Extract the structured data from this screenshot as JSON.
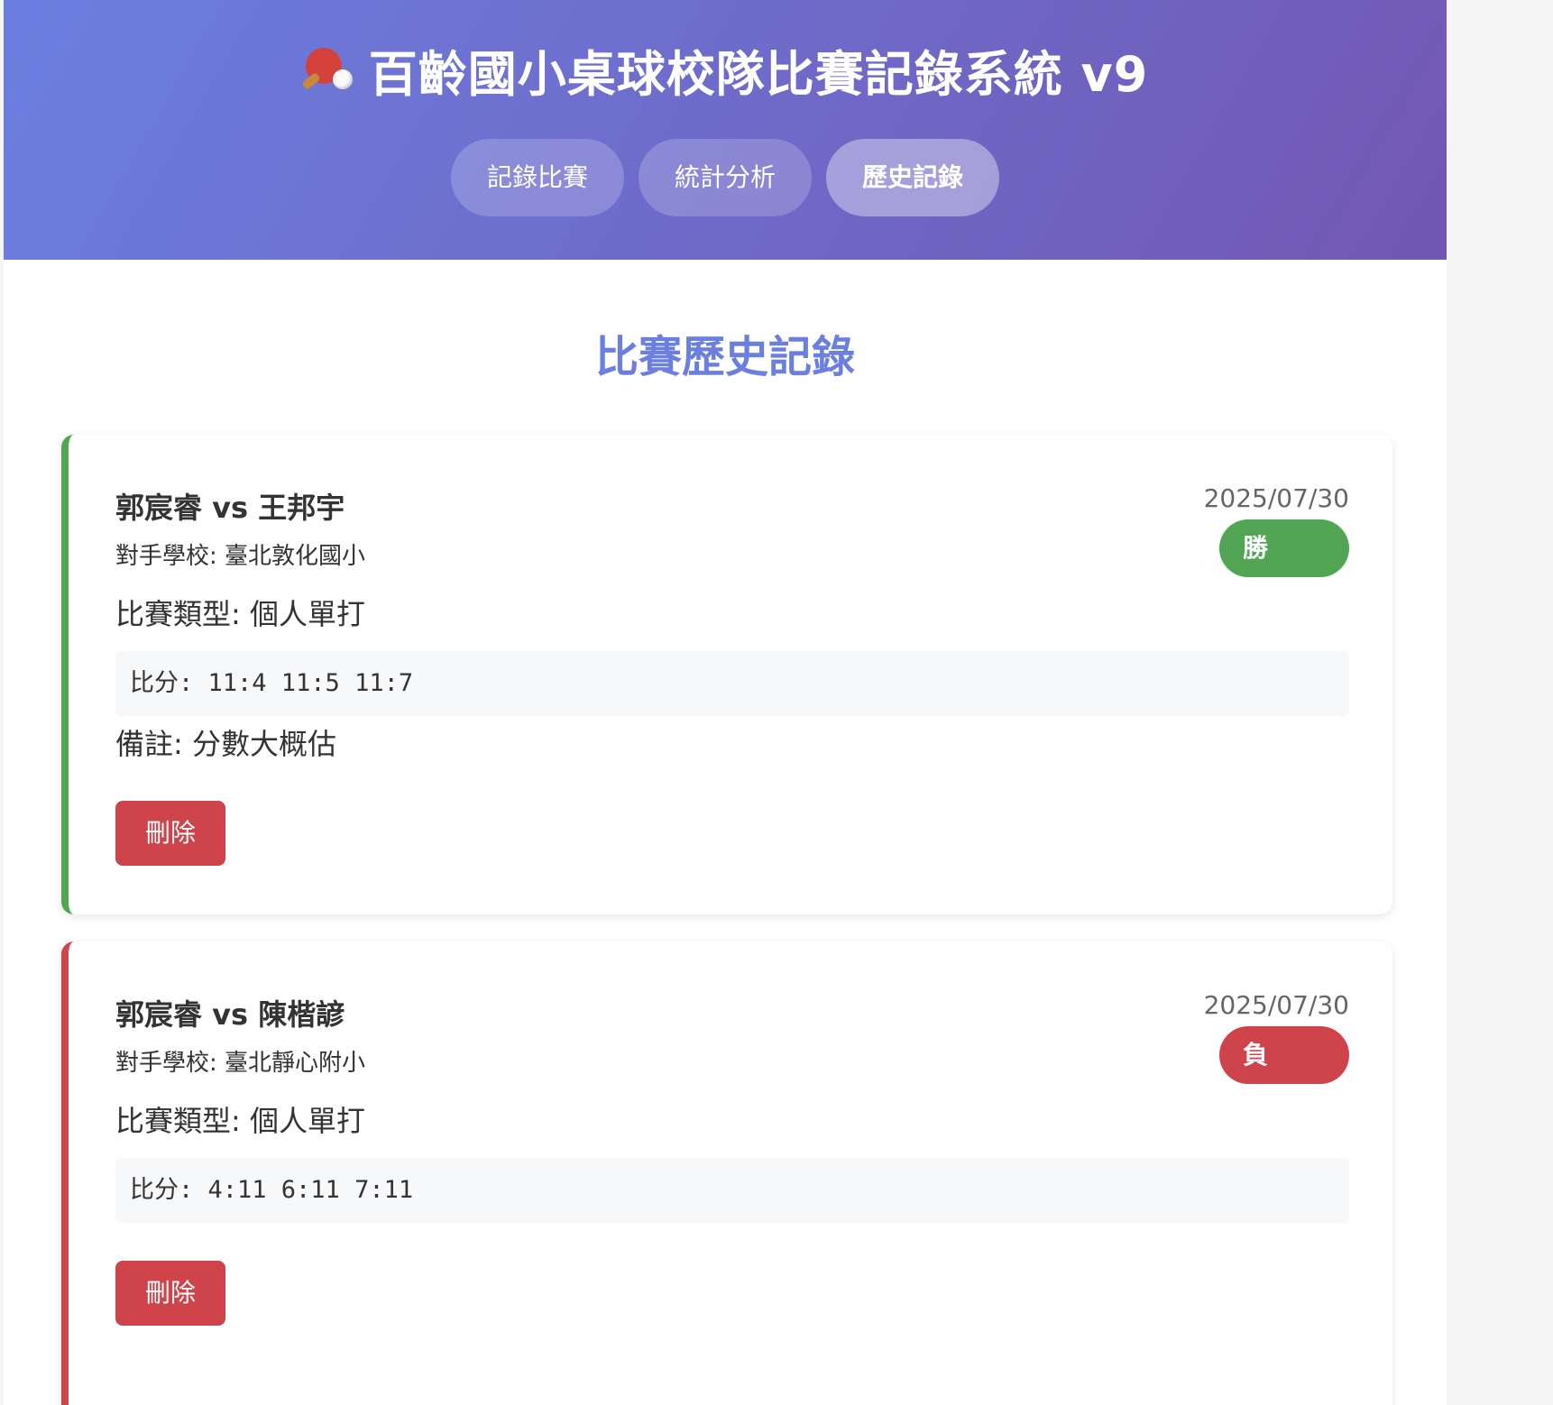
{
  "app": {
    "title": "百齡國小桌球校隊比賽記錄系統 v9",
    "title_icon": "ping-pong-icon"
  },
  "tabs": [
    {
      "label": "記錄比賽",
      "active": false
    },
    {
      "label": "統計分析",
      "active": false
    },
    {
      "label": "歷史記錄",
      "active": true
    }
  ],
  "history": {
    "title": "比賽歷史記錄",
    "matches": [
      {
        "players": "郭宸睿 vs 王邦宇",
        "school": "對手學校: 臺北敦化國小",
        "date": "2025/07/30",
        "result": "勝",
        "type": "比賽類型: 個人單打",
        "score": "比分: 11:4 11:5 11:7",
        "note": "備註: 分數大概估",
        "delete_label": "刪除",
        "result_color": "#52a552"
      },
      {
        "players": "郭宸睿 vs 陳楷諺",
        "school": "對手學校: 臺北靜心附小",
        "date": "2025/07/30",
        "result": "負",
        "type": "比賽類型: 個人單打",
        "score": "比分: 4:11 6:11 7:11",
        "delete_label": "刪除",
        "result_color": "#cf434b"
      }
    ]
  },
  "colors": {
    "header_gradient_start": "#6b7fe0",
    "header_gradient_end": "#7257b3",
    "accent": "#6a7fe0",
    "win": "#52a552",
    "loss": "#cf434b"
  }
}
